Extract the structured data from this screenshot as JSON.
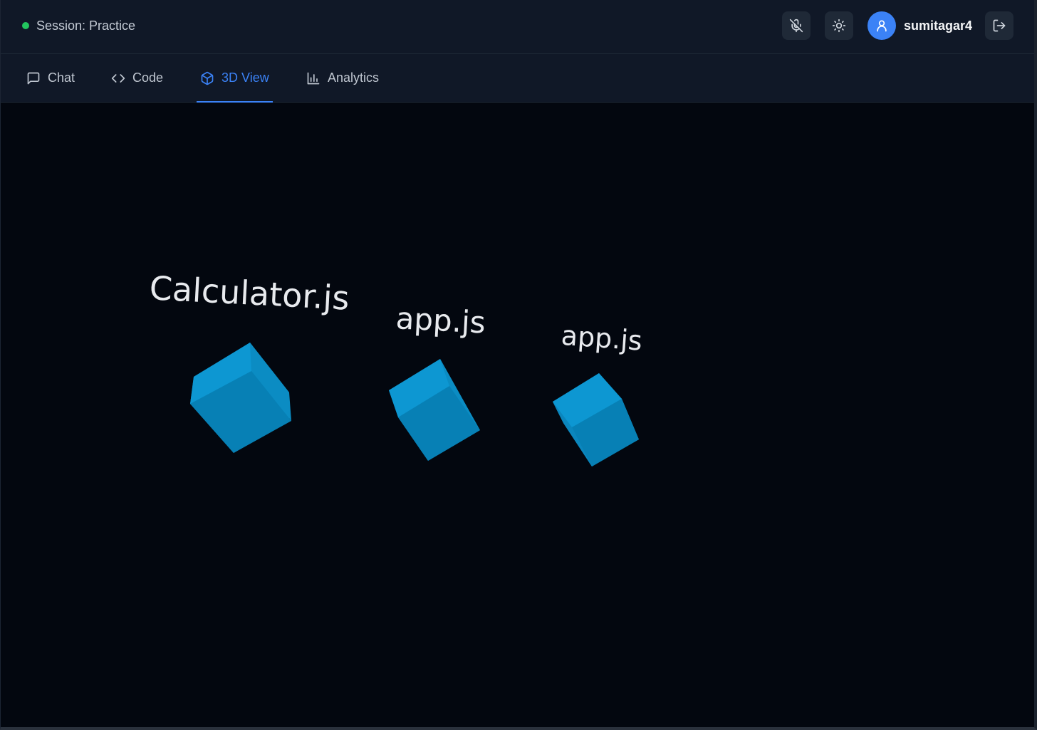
{
  "header": {
    "session_text": "Session: Practice",
    "session_status_color": "#22c55e",
    "username": "sumitagar4",
    "buttons": {
      "mute": "mic-off-icon",
      "theme": "sun-icon",
      "logout": "logout-icon"
    }
  },
  "tabs": [
    {
      "label": "Chat",
      "icon": "message-square-icon",
      "active": false
    },
    {
      "label": "Code",
      "icon": "code-icon",
      "active": false
    },
    {
      "label": "3D View",
      "icon": "box-icon",
      "active": true
    },
    {
      "label": "Analytics",
      "icon": "bar-chart-icon",
      "active": false
    }
  ],
  "scene": {
    "files": [
      {
        "label": "Calculator.js"
      },
      {
        "label": "app.js"
      },
      {
        "label": "app.js"
      }
    ],
    "cube_color": "#0a8fc9"
  },
  "colors": {
    "accent": "#3b82f6",
    "background": "#03070f",
    "panel": "#101827"
  }
}
